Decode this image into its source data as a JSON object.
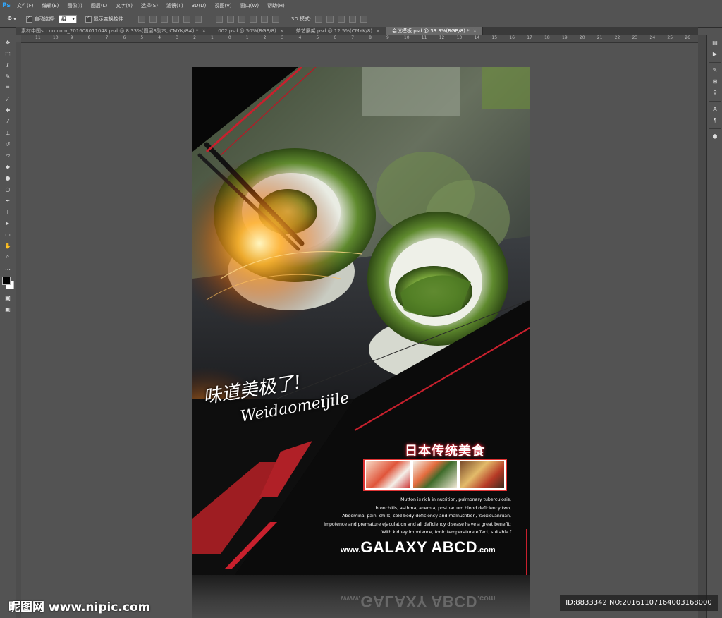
{
  "app": {
    "logo": "Ps"
  },
  "menu": [
    "文件(F)",
    "编辑(E)",
    "图像(I)",
    "图层(L)",
    "文字(Y)",
    "选择(S)",
    "滤镜(T)",
    "3D(D)",
    "视图(V)",
    "窗口(W)",
    "帮助(H)"
  ],
  "options": {
    "auto_select_label": "自动选择:",
    "auto_select_value": "组",
    "show_transform_label": "显示变换控件",
    "mode_3d_label": "3D 模式:"
  },
  "tabs": [
    {
      "label": "素材中国sccnn.com_2016080110​48.psd @ 8.33%(图层3副本, CMYK/8#) *",
      "active": false
    },
    {
      "label": "002.psd @ 50%(RGB/8)",
      "active": false
    },
    {
      "label": "茶艺展架.psd @ 12.5%(CMYK/8)",
      "active": false
    },
    {
      "label": "会议模板.psd @ 33.3%(RGB/8) *",
      "active": true
    }
  ],
  "ruler_marks": [
    "11",
    "10",
    "9",
    "8",
    "7",
    "6",
    "5",
    "4",
    "3",
    "2",
    "1",
    "0",
    "1",
    "2",
    "3",
    "4",
    "5",
    "6",
    "7",
    "8",
    "9",
    "10",
    "11",
    "12",
    "13",
    "14",
    "15",
    "16",
    "17",
    "18",
    "19",
    "20",
    "21",
    "22",
    "23",
    "24",
    "25",
    "26",
    "27"
  ],
  "poster": {
    "script_cn": "味道美极了!",
    "script_en": "Weidaomeijile",
    "title_cn": "日本传统美食",
    "body_lines": [
      "Mutton is rich in nutrition, pulmonary tuberculosis,",
      "bronchitis, asthma, anemia, postpartum blood deficiency two,",
      "Abdominal pain, chills, cold body deficiency and malnutrition, Yaoxisuanruan,",
      "impotence and premature ejaculation and all deficiency disease have a great benefit;",
      "With kidney impotence, tonic temperature effect, suitable f"
    ],
    "brand_prefix": "www.",
    "brand_main": "GALAXY ABCD",
    "brand_suffix": ".com"
  },
  "watermark": {
    "left": "昵图网 www.nipic.com",
    "right": "ID:8833342 NO:20161107164003168000"
  },
  "colors": {
    "accent_red": "#c8202d",
    "bg_dark": "#080808",
    "ui_gray": "#535353"
  }
}
